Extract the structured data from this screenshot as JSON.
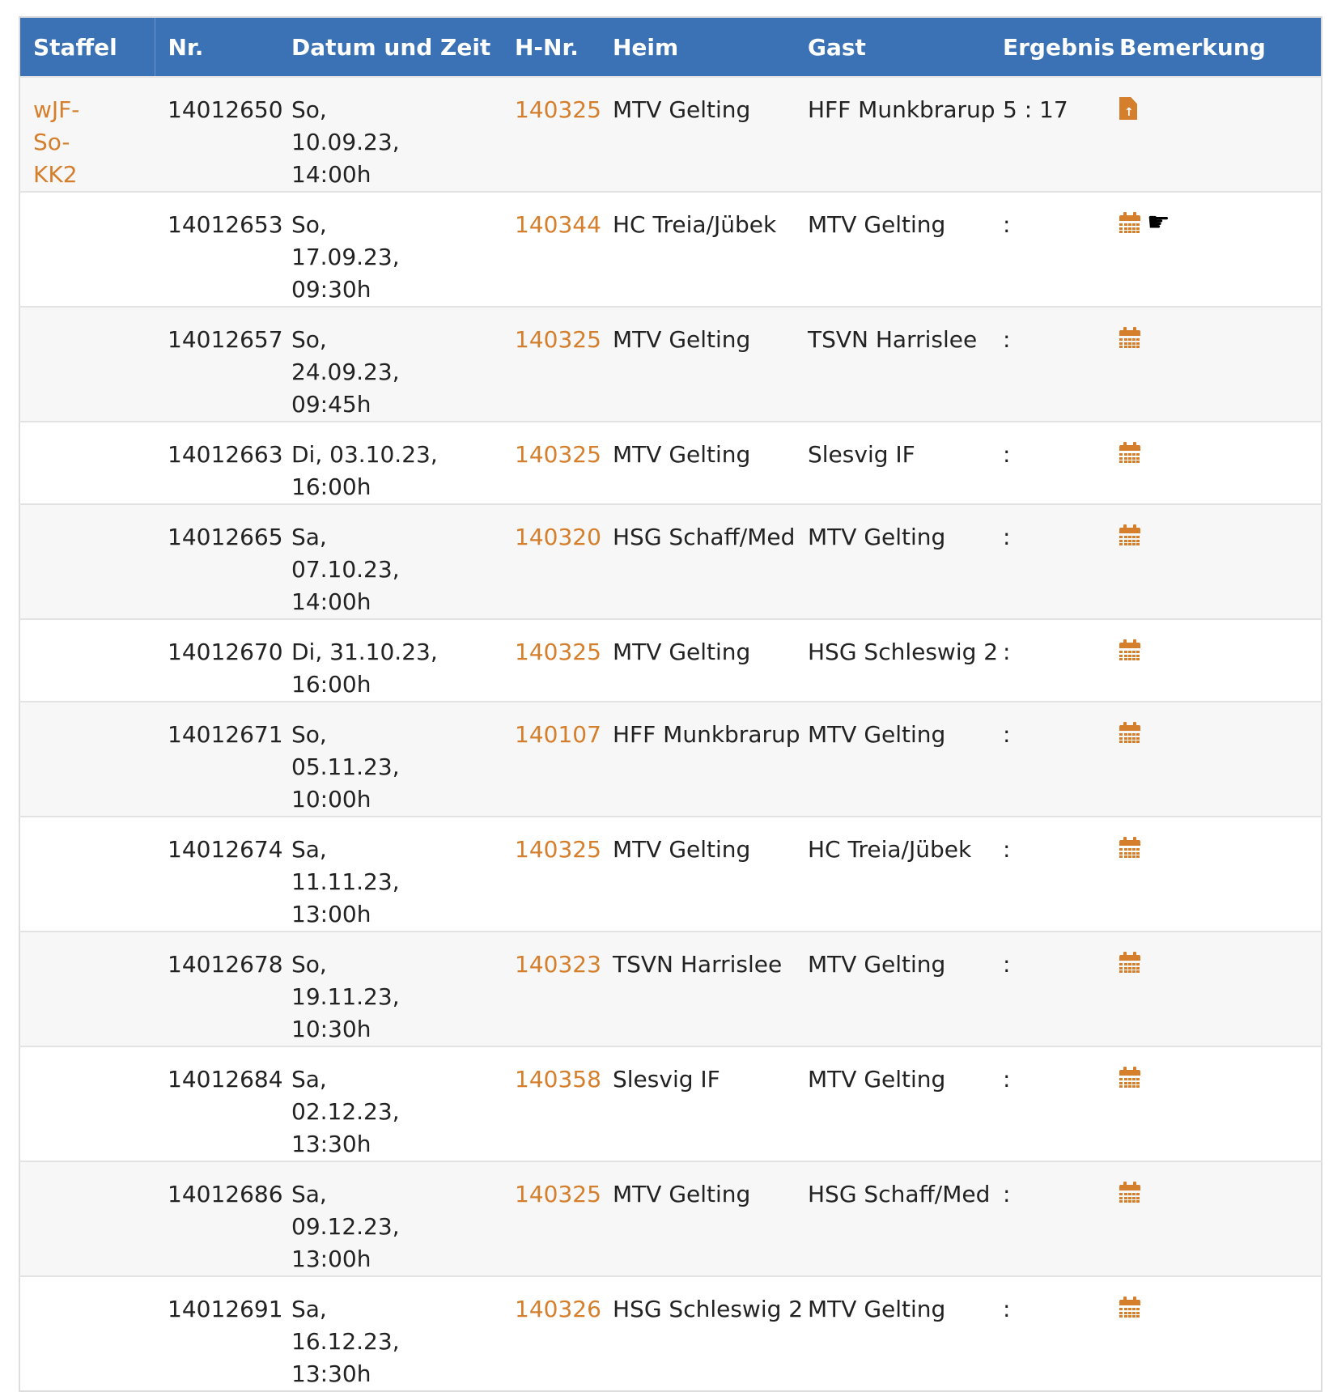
{
  "table": {
    "headers": {
      "staffel": "Staffel",
      "nr": "Nr.",
      "datum": "Datum und Zeit",
      "hnr": "H-Nr.",
      "heim": "Heim",
      "gast": "Gast",
      "ergebnis": "Ergebnis",
      "bemerkung": "Bemerkung"
    },
    "rows": [
      {
        "staffel": "wJF-So-KK2",
        "nr": "14012650",
        "datum": "So, 10.09.23, 14:00h",
        "hnr": "140325",
        "heim": "MTV Gelting",
        "gast": "HFF Munkbrarup",
        "ergebnis": "5 : 17",
        "icon": "document-upload-icon"
      },
      {
        "staffel": "",
        "nr": "14012653",
        "datum": "So, 17.09.23, 09:30h",
        "hnr": "140344",
        "heim": "HC Treia/Jübek",
        "gast": "MTV Gelting",
        "ergebnis": ":",
        "icon": "calendar-icon",
        "extra_icon": "pointing-hand-icon"
      },
      {
        "staffel": "",
        "nr": "14012657",
        "datum": "So, 24.09.23, 09:45h",
        "hnr": "140325",
        "heim": "MTV Gelting",
        "gast": "TSVN Harrislee",
        "ergebnis": ":",
        "icon": "calendar-icon"
      },
      {
        "staffel": "",
        "nr": "14012663",
        "datum": "Di, 03.10.23, 16:00h",
        "hnr": "140325",
        "heim": "MTV Gelting",
        "gast": "Slesvig IF",
        "ergebnis": ":",
        "icon": "calendar-icon"
      },
      {
        "staffel": "",
        "nr": "14012665",
        "datum": "Sa, 07.10.23, 14:00h",
        "hnr": "140320",
        "heim": "HSG Schaff/Med",
        "gast": "MTV Gelting",
        "ergebnis": ":",
        "icon": "calendar-icon"
      },
      {
        "staffel": "",
        "nr": "14012670",
        "datum": "Di, 31.10.23, 16:00h",
        "hnr": "140325",
        "heim": "MTV Gelting",
        "gast": "HSG Schleswig 2",
        "ergebnis": ":",
        "icon": "calendar-icon"
      },
      {
        "staffel": "",
        "nr": "14012671",
        "datum": "So, 05.11.23, 10:00h",
        "hnr": "140107",
        "heim": "HFF Munkbrarup",
        "gast": "MTV Gelting",
        "ergebnis": ":",
        "icon": "calendar-icon"
      },
      {
        "staffel": "",
        "nr": "14012674",
        "datum": "Sa, 11.11.23, 13:00h",
        "hnr": "140325",
        "heim": "MTV Gelting",
        "gast": "HC Treia/Jübek",
        "ergebnis": ":",
        "icon": "calendar-icon"
      },
      {
        "staffel": "",
        "nr": "14012678",
        "datum": "So, 19.11.23, 10:30h",
        "hnr": "140323",
        "heim": "TSVN Harrislee",
        "gast": "MTV Gelting",
        "ergebnis": ":",
        "icon": "calendar-icon"
      },
      {
        "staffel": "",
        "nr": "14012684",
        "datum": "Sa, 02.12.23, 13:30h",
        "hnr": "140358",
        "heim": "Slesvig IF",
        "gast": "MTV Gelting",
        "ergebnis": ":",
        "icon": "calendar-icon"
      },
      {
        "staffel": "",
        "nr": "14012686",
        "datum": "Sa, 09.12.23, 13:00h",
        "hnr": "140325",
        "heim": "MTV Gelting",
        "gast": "HSG Schaff/Med",
        "ergebnis": ":",
        "icon": "calendar-icon"
      },
      {
        "staffel": "",
        "nr": "14012691",
        "datum": "Sa, 16.12.23, 13:30h",
        "hnr": "140326",
        "heim": "HSG Schleswig 2",
        "gast": "MTV Gelting",
        "ergebnis": ":",
        "icon": "calendar-icon"
      }
    ]
  },
  "colors": {
    "header_bg": "#3a72b5",
    "link": "#d57f2c",
    "row_alt": "#f7f7f7"
  }
}
